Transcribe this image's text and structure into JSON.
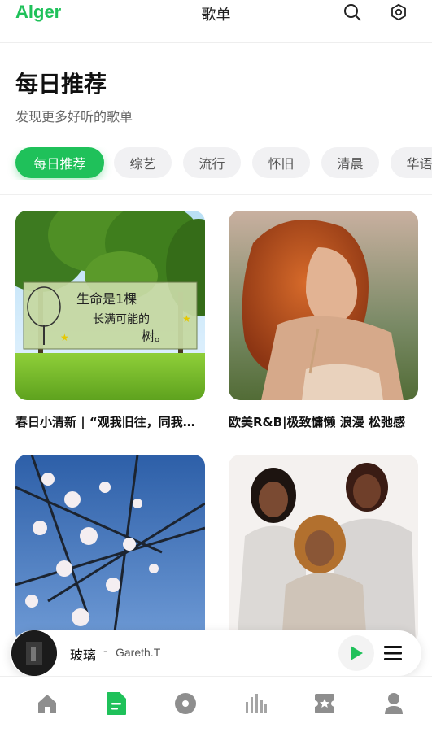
{
  "header": {
    "logo": "Alger",
    "title": "歌单",
    "search_icon": "search-icon",
    "settings_icon": "gear-icon"
  },
  "main": {
    "title": "每日推荐",
    "subtitle": "发现更多好听的歌单"
  },
  "categories": [
    {
      "label": "每日推荐",
      "active": true
    },
    {
      "label": "综艺",
      "active": false
    },
    {
      "label": "流行",
      "active": false
    },
    {
      "label": "怀旧",
      "active": false
    },
    {
      "label": "清晨",
      "active": false
    },
    {
      "label": "华语",
      "active": false
    }
  ],
  "playlists": [
    {
      "title": "春日小清新 | “观我旧往，同我…",
      "cover_sign": [
        "生命是1棵",
        "长满可能的",
        "树。"
      ]
    },
    {
      "title": "欧美R&B|极致慵懒 浪漫 松弛感"
    },
    {
      "title": ""
    },
    {
      "title": ""
    }
  ],
  "player": {
    "song": "玻璃",
    "separator": "-",
    "artist": "Gareth.T",
    "play_icon": "play-icon",
    "queue_icon": "playlist-icon"
  },
  "nav": {
    "items": [
      "home-icon",
      "playlist-doc-icon",
      "album-icon",
      "chart-icon",
      "ticket-icon",
      "user-icon"
    ],
    "active_index": 1
  },
  "colors": {
    "accent": "#1fc15a",
    "chip_bg": "#f1f1f3",
    "nav_icon": "#8e8e8e"
  }
}
